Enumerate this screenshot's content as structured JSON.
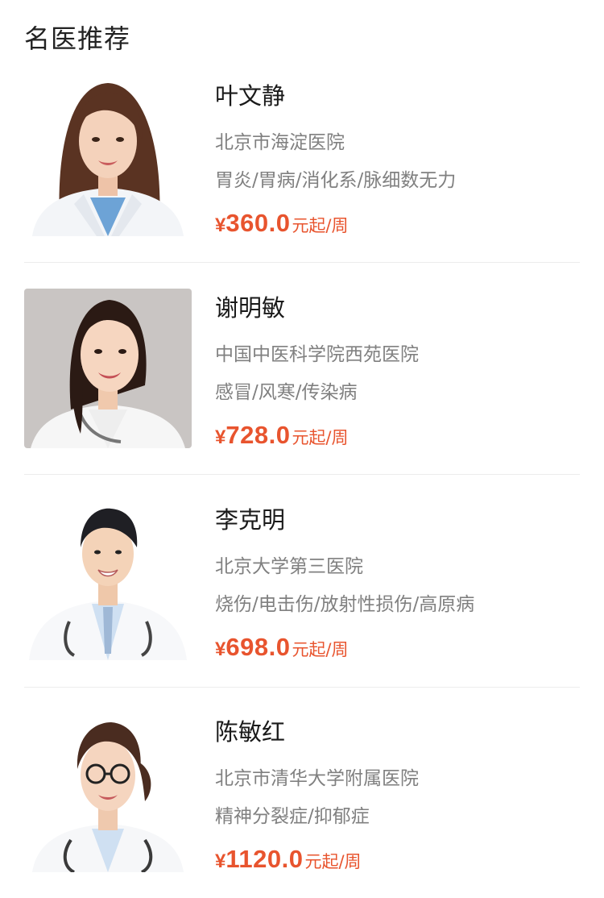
{
  "section": {
    "title": "名医推荐"
  },
  "doctors": [
    {
      "name": "叶文静",
      "hospital": "北京市海淀医院",
      "specialty": "胃炎/胃病/消化系/脉细数无力",
      "currency": "¥",
      "price": "360.0",
      "unit": "元起/周",
      "photo_icon": "female-doctor-portrait"
    },
    {
      "name": "谢明敏",
      "hospital": "中国中医科学院西苑医院",
      "specialty": "感冒/风寒/传染病",
      "currency": "¥",
      "price": "728.0",
      "unit": "元起/周",
      "photo_icon": "female-doctor-portrait"
    },
    {
      "name": "李克明",
      "hospital": "北京大学第三医院",
      "specialty": "烧伤/电击伤/放射性损伤/高原病",
      "currency": "¥",
      "price": "698.0",
      "unit": "元起/周",
      "photo_icon": "male-doctor-portrait"
    },
    {
      "name": "陈敏红",
      "hospital": "北京市清华大学附属医院",
      "specialty": "精神分裂症/抑郁症",
      "currency": "¥",
      "price": "1120.0",
      "unit": "元起/周",
      "photo_icon": "female-doctor-portrait"
    }
  ],
  "colors": {
    "price": "#e8542e",
    "name": "#1a1a1a",
    "secondary_text": "#808080",
    "divider": "#ececec"
  }
}
